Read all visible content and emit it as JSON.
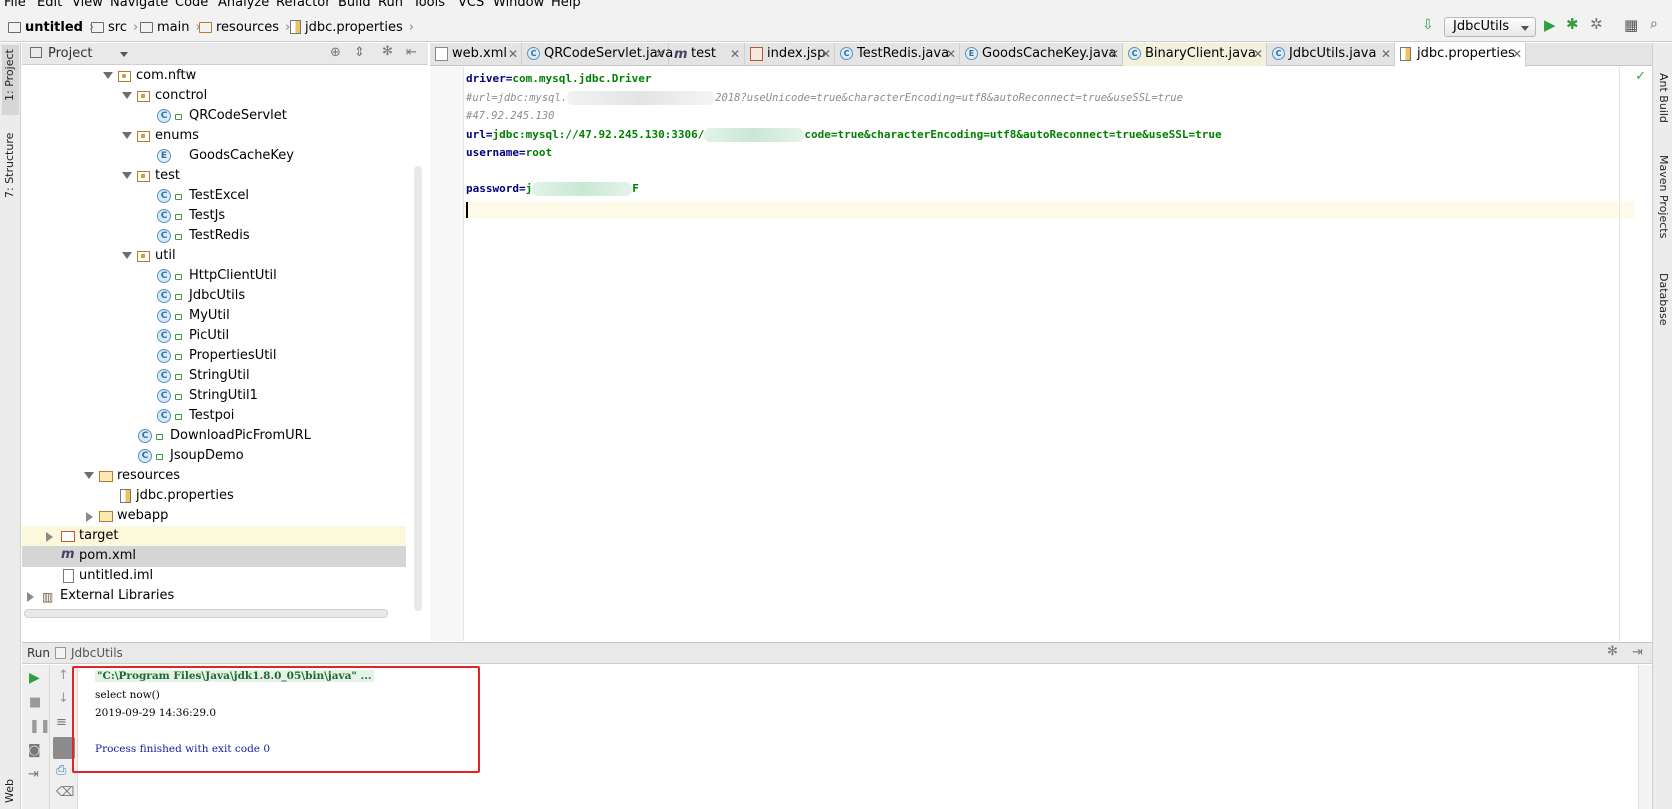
{
  "menu": [
    "File",
    "Edit",
    "View",
    "Navigate",
    "Code",
    "Analyze",
    "Refactor",
    "Build",
    "Run",
    "Tools",
    "VCS",
    "Window",
    "Help"
  ],
  "breadcrumb": [
    "untitled",
    "src",
    "main",
    "resources",
    "jdbc.properties"
  ],
  "run_config": "JdbcUtils",
  "left_strip": {
    "project": "1: Project",
    "structure": "7: Structure",
    "web": "Web"
  },
  "right_strip": {
    "ant": "Ant Build",
    "maven": "Maven Projects",
    "database": "Database"
  },
  "project_panel": {
    "title": "Project",
    "tree": [
      {
        "label": "com.nftw",
        "kind": "package",
        "open": true
      },
      {
        "label": "conctrol",
        "kind": "package",
        "open": true
      },
      {
        "label": "QRCodeServlet",
        "kind": "class"
      },
      {
        "label": "enums",
        "kind": "package",
        "open": true
      },
      {
        "label": "GoodsCacheKey",
        "kind": "enum"
      },
      {
        "label": "test",
        "kind": "package",
        "open": true
      },
      {
        "label": "TestExcel",
        "kind": "class"
      },
      {
        "label": "TestJs",
        "kind": "class"
      },
      {
        "label": "TestRedis",
        "kind": "class"
      },
      {
        "label": "util",
        "kind": "package",
        "open": true
      },
      {
        "label": "HttpClientUtil",
        "kind": "class"
      },
      {
        "label": "JdbcUtils",
        "kind": "class"
      },
      {
        "label": "MyUtil",
        "kind": "class"
      },
      {
        "label": "PicUtil",
        "kind": "class"
      },
      {
        "label": "PropertiesUtil",
        "kind": "class"
      },
      {
        "label": "StringUtil",
        "kind": "class"
      },
      {
        "label": "StringUtil1",
        "kind": "class"
      },
      {
        "label": "Testpoi",
        "kind": "class"
      },
      {
        "label": "DownloadPicFromURL",
        "kind": "class"
      },
      {
        "label": "JsoupDemo",
        "kind": "class"
      },
      {
        "label": "resources",
        "kind": "folder",
        "open": true
      },
      {
        "label": "jdbc.properties",
        "kind": "file"
      },
      {
        "label": "webapp",
        "kind": "folder",
        "open": false
      },
      {
        "label": "target",
        "kind": "folder-excluded",
        "open": false
      },
      {
        "label": "pom.xml",
        "kind": "maven",
        "selected": true
      },
      {
        "label": "untitled.iml",
        "kind": "file"
      },
      {
        "label": "External Libraries",
        "kind": "library",
        "open": false
      }
    ]
  },
  "tabs": [
    {
      "label": "web.xml"
    },
    {
      "label": "QRCodeServlet.java"
    },
    {
      "label": "test"
    },
    {
      "label": "index.jsp"
    },
    {
      "label": "TestRedis.java"
    },
    {
      "label": "GoodsCacheKey.java"
    },
    {
      "label": "BinaryClient.java"
    },
    {
      "label": "JdbcUtils.java"
    },
    {
      "label": "jdbc.properties",
      "active": true
    }
  ],
  "editor": {
    "line1_key": "driver",
    "line1_eq": "=",
    "line1_val_a": "com.mysql",
    "line1_val_b": ".jdbc.Driver",
    "line2_a": "#url=jdbc:mysql.",
    "line2_b": "2018?useUnicode=true&characterEncoding=utf8&autoReconnect=true&useSSL=true",
    "line3": "#47.92.245.130",
    "line4_key": "url",
    "line4_eq": "=",
    "line4_val_a": "jdbc:mysql://47.92.245.130:3306/",
    "line4_val_b": "code=true&characterEncoding=utf8&autoReconnect=true&useSSL=true",
    "line5_key": "username",
    "line5_eq": "=",
    "line5_val": "root",
    "line7_key": "password",
    "line7_eq": "=",
    "line7_val_a": "j",
    "line7_val_b": "F"
  },
  "run_panel": {
    "title": "Run",
    "config": "JdbcUtils",
    "console": [
      "\"C:\\Program Files\\Java\\jdk1.8.0_05\\bin\\java\" ...",
      "select now()",
      "2019-09-29 14:36:29.0",
      "",
      "Process finished with exit code 0"
    ]
  }
}
